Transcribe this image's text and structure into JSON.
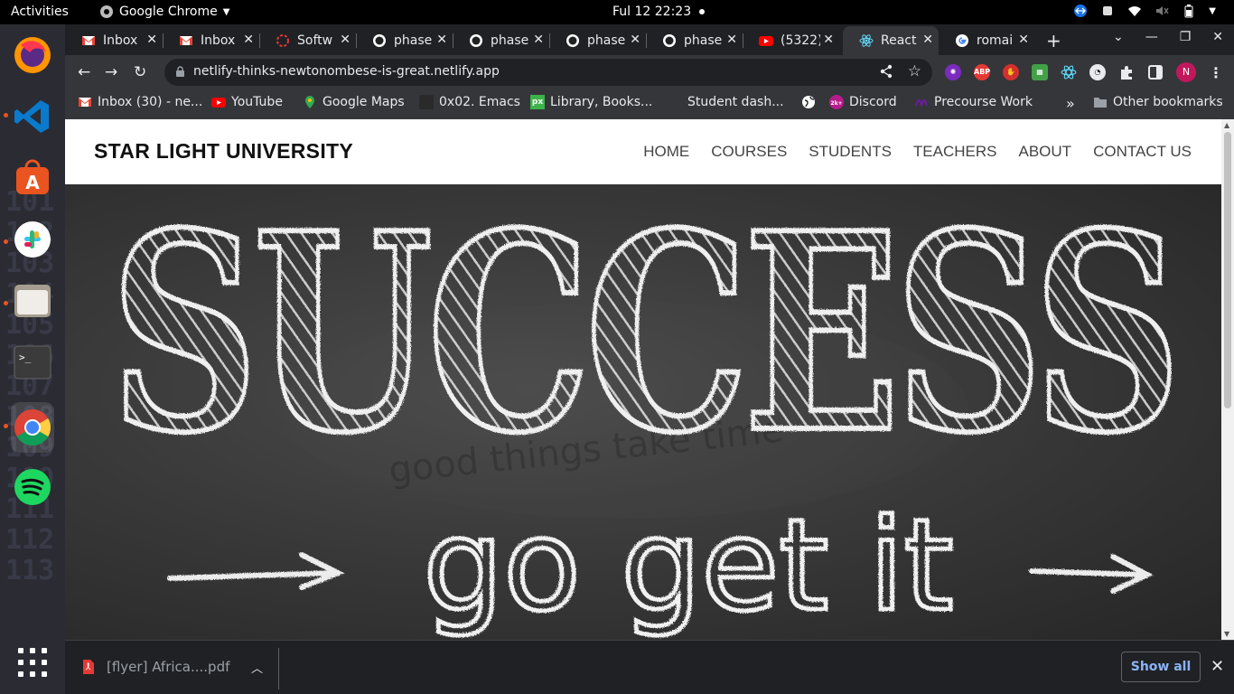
{
  "system": {
    "activities": "Activities",
    "app_menu": "Google Chrome",
    "clock": "Ful 12  22:23"
  },
  "tabs": [
    {
      "title": "Inbox",
      "icon": "gmail-icon"
    },
    {
      "title": "Inbox",
      "icon": "gmail-icon"
    },
    {
      "title": "Softw",
      "icon": "loading-icon"
    },
    {
      "title": "phase",
      "icon": "github-icon"
    },
    {
      "title": "phase",
      "icon": "github-icon"
    },
    {
      "title": "phase",
      "icon": "github-icon"
    },
    {
      "title": "phase",
      "icon": "github-icon"
    },
    {
      "title": "(5322)",
      "icon": "youtube-icon"
    },
    {
      "title": "React",
      "icon": "react-icon",
      "active": true
    },
    {
      "title": "romai",
      "icon": "google-icon"
    }
  ],
  "toolbar": {
    "url": "netlify-thinks-newtonombese-is-great.netlify.app",
    "profile_initial": "N"
  },
  "bookmarks": [
    {
      "label": "Inbox (30) - ne...",
      "icon": "gmail-icon"
    },
    {
      "label": "YouTube",
      "icon": "youtube-icon"
    },
    {
      "label": "Google Maps",
      "icon": "maps-icon"
    },
    {
      "label": "0x02. Emacs",
      "icon": "holberton-icon"
    },
    {
      "label": "Library, Books...",
      "icon": "px-icon"
    },
    {
      "label": "Student dash...",
      "icon": "dash-icon"
    },
    {
      "label": "",
      "icon": "globe-icon"
    },
    {
      "label": "Discord",
      "icon": "discord-icon"
    },
    {
      "label": "Precourse Work",
      "icon": "precourse-icon"
    }
  ],
  "bookmarks_more": "»",
  "other_bookmarks": "Other bookmarks",
  "site": {
    "brand": "STAR LIGHT UNIVERSITY",
    "nav": [
      "HOME",
      "COURSES",
      "STUDENTS",
      "TEACHERS",
      "ABOUT",
      "CONTACT US"
    ],
    "hero_text_main": "SUCCESS",
    "hero_text_sub": "go get it"
  },
  "downloads": {
    "file_name": "[flyer] Africa....pdf",
    "show_all": "Show all"
  },
  "colors": {
    "chrome_dark": "#202124",
    "chrome_toolbar": "#35363a",
    "dock": "#2b2b33",
    "accent_link": "#8ab4f8",
    "chalk": "#e9e9e9"
  }
}
